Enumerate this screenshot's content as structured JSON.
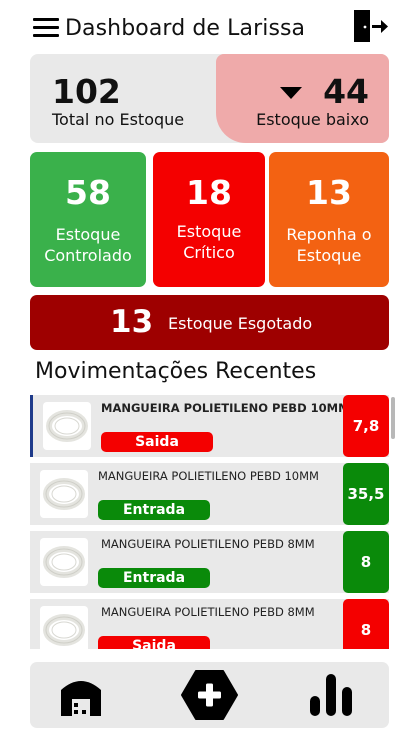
{
  "header": {
    "title": "Dashboard de Larissa",
    "menu_icon": "hamburger-menu-icon",
    "logout_icon": "exit-door-icon"
  },
  "summary": {
    "total_value": "102",
    "total_label": "Total no Estoque",
    "low_value": "44",
    "low_label": "Estoque baixo"
  },
  "stats": [
    {
      "value": "58",
      "label": "Estoque\nControlado",
      "color": "#3ab14b"
    },
    {
      "value": "18",
      "label": "Estoque\nCrítico",
      "color": "#f40000"
    },
    {
      "value": "13",
      "label": "Reponha o\nEstoque",
      "color": "#f36212"
    }
  ],
  "out_of_stock": {
    "value": "13",
    "label": "Estoque Esgotado",
    "color": "#9e0000"
  },
  "recent": {
    "title": "Movimentações Recentes",
    "items": [
      {
        "name": "MANGUEIRA POLIETILENO PEBD 10MM",
        "type": "Saida",
        "qty": "7,8"
      },
      {
        "name": "MANGUEIRA POLIETILENO PEBD 10MM",
        "type": "Entrada",
        "qty": "35,5"
      },
      {
        "name": "MANGUEIRA POLIETILENO PEBD 8MM",
        "type": "Entrada",
        "qty": "8"
      },
      {
        "name": "MANGUEIRA POLIETILENO PEBD 8MM",
        "type": "Saida",
        "qty": "8"
      }
    ]
  },
  "nav": {
    "home_icon": "warehouse-icon",
    "add_icon": "add-icon",
    "reports_icon": "bar-chart-icon"
  },
  "colors": {
    "green": "#3ab14b",
    "red": "#f40000",
    "orange": "#f36212",
    "dark_red": "#9e0000",
    "pink": "#efaaaa",
    "card_gray": "#e9e9e9"
  }
}
